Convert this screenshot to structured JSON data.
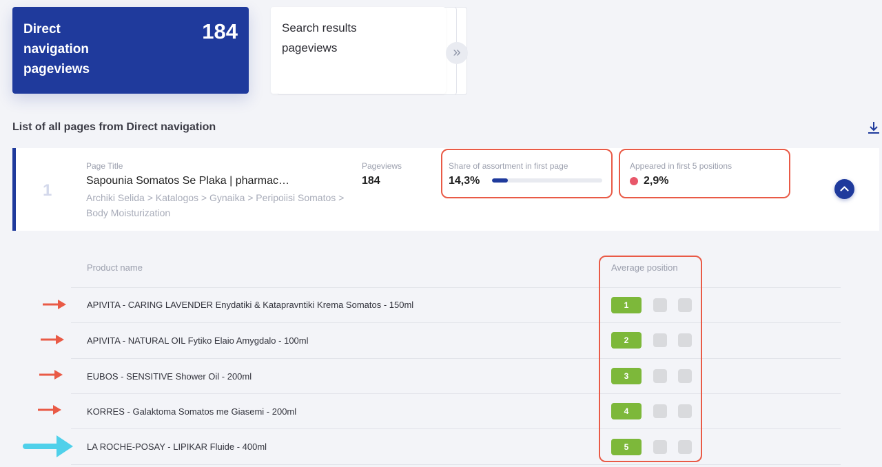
{
  "cards": {
    "direct": {
      "label": "Direct navigation pageviews",
      "value": "184"
    },
    "search": {
      "label": "Search results pageviews"
    },
    "expand_icon": "double-chevron-right-icon"
  },
  "section": {
    "title": "List of all pages from Direct navigation",
    "download_icon": "download-icon"
  },
  "page_row": {
    "index": "1",
    "page_title_label": "Page Title",
    "page_title": "Sapounia Somatos Se Plaka | pharmac…",
    "breadcrumb": "Archiki Selida > Katalogos > Gynaika > Peripoiisi Somatos > Body Moisturization",
    "pageviews_label": "Pageviews",
    "pageviews": "184",
    "share_label": "Share of assortment in first page",
    "share_value": "14,3%",
    "share_fraction": 0.143,
    "appeared_label": "Appeared in first 5 positions",
    "appeared_value": "2,9%",
    "appeared_dot_color": "#e8576a",
    "collapse_icon": "chevron-up-icon"
  },
  "table": {
    "product_header": "Product name",
    "position_header": "Average position",
    "rows": [
      {
        "product": "APIVITA - CARING LAVENDER Enydatiki & Katapravntiki Krema Somatos - 150ml",
        "position": "1"
      },
      {
        "product": "APIVITA - NATURAL OIL Fytiko Elaio Amygdalo - 100ml",
        "position": "2"
      },
      {
        "product": "EUBOS - SENSITIVE Shower Oil - 200ml",
        "position": "3"
      },
      {
        "product": "KORRES - Galaktoma Somatos me Giasemi - 200ml",
        "position": "4"
      },
      {
        "product": "LA ROCHE-POSAY - LIPIKAR Fluide - 400ml",
        "position": "5"
      }
    ]
  },
  "colors": {
    "brand_blue": "#1f3a9c",
    "position_green": "#7db83a",
    "annotation_red": "#e95a46",
    "annotation_cyan": "#4fd0ea"
  }
}
